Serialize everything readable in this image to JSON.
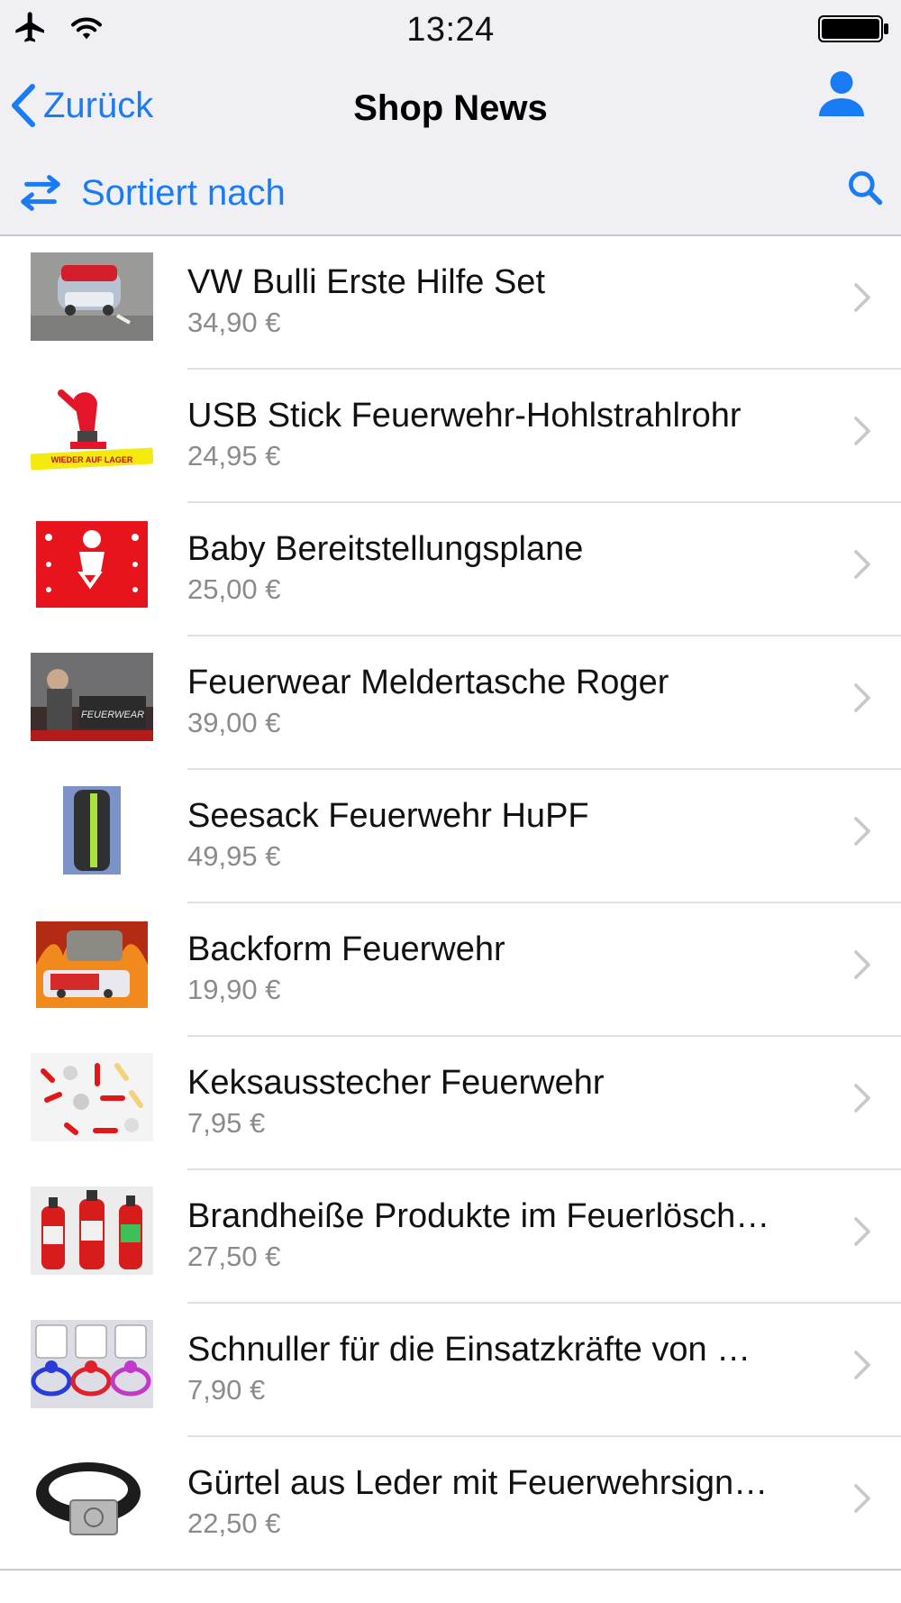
{
  "status": {
    "time": "13:24"
  },
  "nav": {
    "back_label": "Zurück",
    "title": "Shop News"
  },
  "sort": {
    "label": "Sortiert nach"
  },
  "accent_color": "#1a7cf5",
  "items": [
    {
      "title": "VW Bulli Erste Hilfe Set",
      "price": "34,90 €"
    },
    {
      "title": "USB Stick Feuerwehr-Hohlstrahlrohr",
      "price": "24,95 €"
    },
    {
      "title": "Baby Bereitstellungsplane",
      "price": "25,00 €"
    },
    {
      "title": "Feuerwear Meldertasche Roger",
      "price": "39,00 €"
    },
    {
      "title": "Seesack Feuerwehr HuPF",
      "price": "49,95 €"
    },
    {
      "title": "Backform Feuerwehr",
      "price": "19,90 €"
    },
    {
      "title": "Keksausstecher Feuerwehr",
      "price": "7,95 €"
    },
    {
      "title": "Brandheiße Produkte im Feuerlösch…",
      "price": "27,50 €"
    },
    {
      "title": "Schnuller für die Einsatzkräfte von …",
      "price": "7,90 €"
    },
    {
      "title": "Gürtel aus Leder mit Feuerwehrsign…",
      "price": "22,50 €"
    }
  ],
  "thumbnail_text": {
    "item_2": "WIEDER AUF LAGER",
    "item_4": "FEUERWEAR"
  }
}
